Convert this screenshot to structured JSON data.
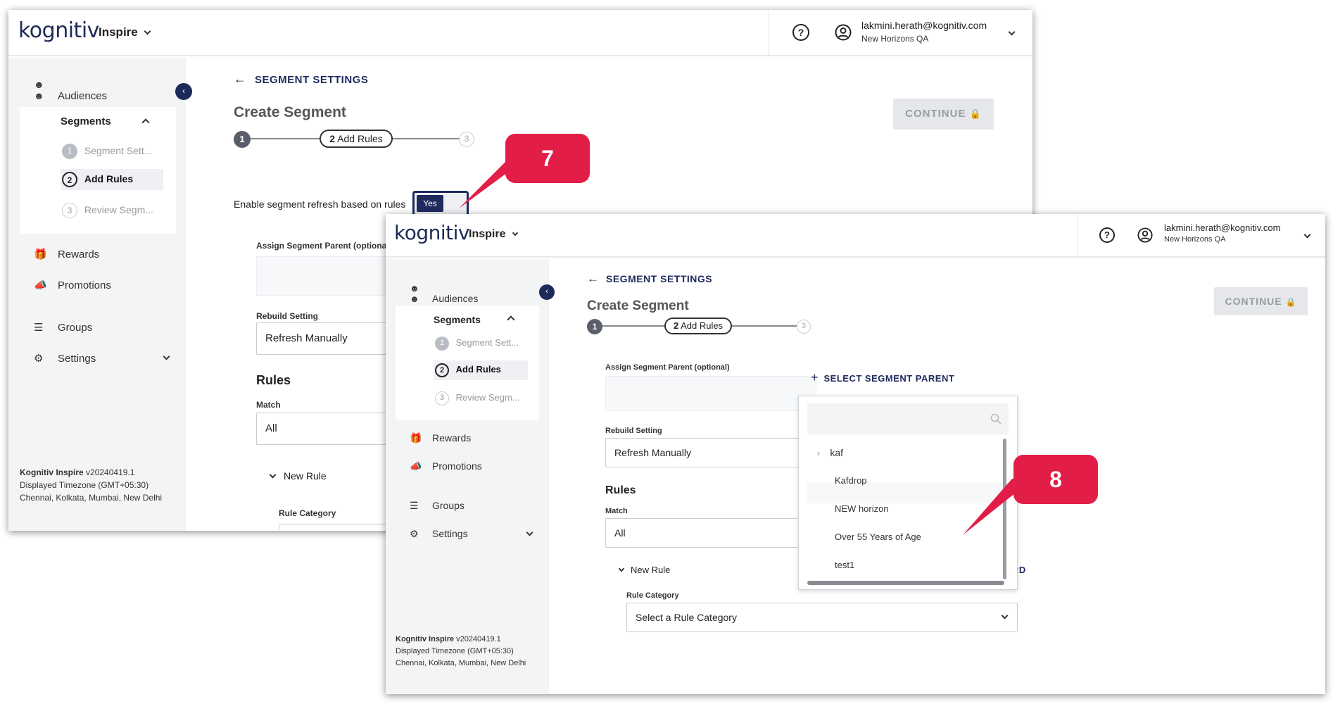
{
  "brand": {
    "logo_text": "kognitiv",
    "app_name": "Inspire"
  },
  "user": {
    "email": "lakmini.herath@kognitiv.com",
    "org": "New Horizons QA"
  },
  "sidebar": {
    "audiences": "Audiences",
    "segments": "Segments",
    "steps": [
      {
        "num": "1",
        "label": "Segment Sett..."
      },
      {
        "num": "2",
        "label": "Add Rules"
      },
      {
        "num": "3",
        "label": "Review Segm..."
      }
    ],
    "rewards": "Rewards",
    "promotions": "Promotions",
    "groups": "Groups",
    "settings": "Settings"
  },
  "footer": {
    "brand": "Kognitiv Inspire",
    "version": " v20240419.1",
    "timezone": "Displayed Timezone (GMT+05:30)",
    "cities": "Chennai, Kolkata, Mumbai, New Delhi"
  },
  "main": {
    "back_link": "SEGMENT SETTINGS",
    "title": "Create Segment",
    "continue": "CONTINUE",
    "stepper": {
      "step1": "1",
      "step2": "2",
      "step2_label": "Add Rules",
      "step3": "3"
    },
    "refresh_label": "Enable segment refresh based on rules",
    "toggle_value": "Yes",
    "parent_label": "Assign Segment Parent (optional)",
    "rebuild_label": "Rebuild Setting",
    "rebuild_value": "Refresh Manually",
    "rules_heading": "Rules",
    "match_label": "Match",
    "match_value": "All",
    "new_rule": "New Rule",
    "rule_category_label": "Rule Category",
    "rule_category_placeholder": "Select a Rule Category",
    "select_parent": "SELECT SEGMENT PARENT",
    "discard_partial": "DISCARD"
  },
  "dropdown": {
    "items": [
      "kaf",
      "Kafdrop",
      "NEW horizon",
      "Over 55 Years of Age",
      "test1"
    ]
  },
  "callouts": {
    "first": "7",
    "second": "8"
  },
  "colors": {
    "accent": "#e21d47",
    "navy": "#1f2a5e",
    "teal": "#1ab5b5"
  }
}
